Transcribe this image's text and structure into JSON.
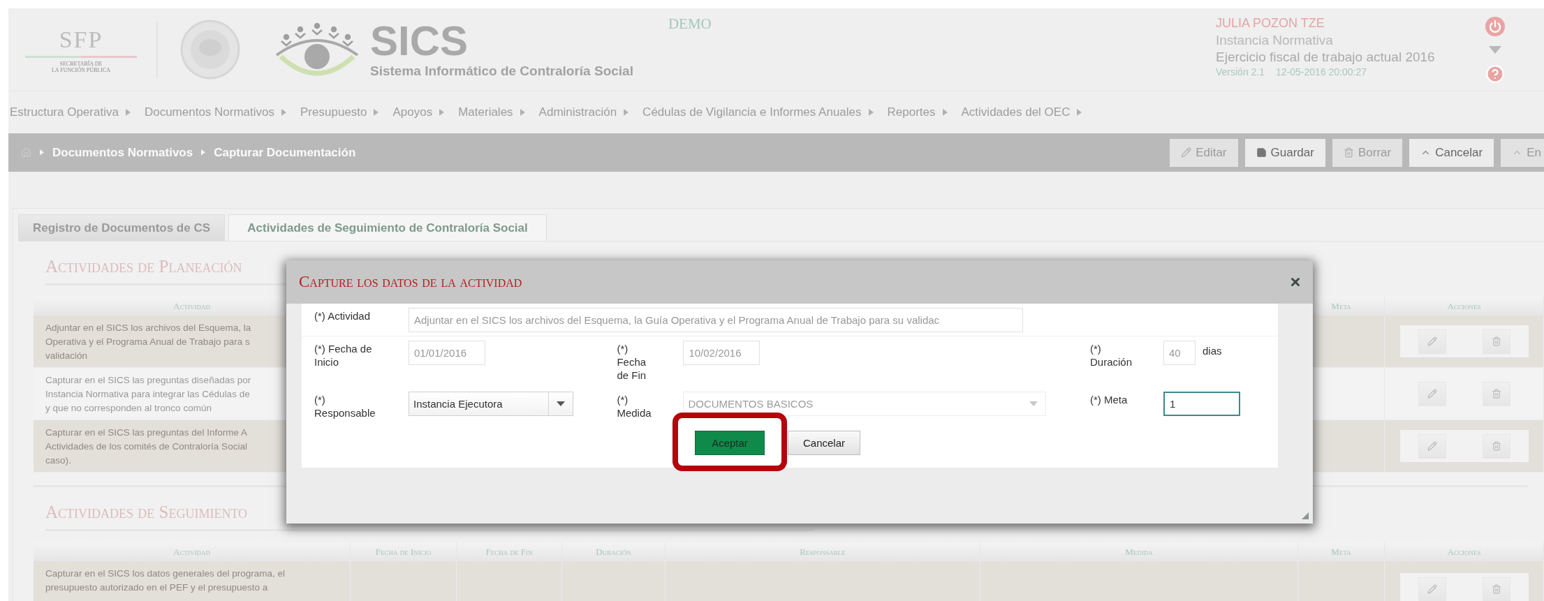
{
  "header": {
    "sfp_logo": {
      "title": "SFP",
      "lines": [
        "SECRETARÍA DE",
        "LA FUNCIÓN PÚBLICA"
      ]
    },
    "app": {
      "name": "SICS",
      "subtitle": "Sistema Informático de Contraloría Social"
    },
    "environment": "DEMO",
    "user": {
      "name": "JULIA POZON TZE",
      "role": "Instancia Normativa",
      "fiscal_year": "Ejercicio fiscal de trabajo actual  2016",
      "version": "Versión 2.1",
      "timestamp": "12-05-2016 20:00:27"
    }
  },
  "menu": [
    "Estructura Operativa",
    "Documentos Normativos",
    "Presupuesto",
    "Apoyos",
    "Materiales",
    "Administración",
    "Cédulas de Vigilancia e Informes Anuales",
    "Reportes",
    "Actividades del OEC"
  ],
  "breadcrumb": [
    "Documentos Normativos",
    "Capturar Documentación"
  ],
  "toolbar": [
    {
      "label": "Editar",
      "disabled": true
    },
    {
      "label": "Guardar",
      "disabled": false
    },
    {
      "label": "Borrar",
      "disabled": true
    },
    {
      "label": "Cancelar",
      "disabled": false
    },
    {
      "label": "En",
      "disabled": true
    }
  ],
  "tabs": [
    {
      "label": "Registro de Documentos de CS",
      "selected": false
    },
    {
      "label": "Actividades de Seguimiento de Contraloría Social",
      "selected": true
    }
  ],
  "sections": [
    {
      "title": "Actividades de Planeación",
      "columns": [
        {
          "label": "Actividad",
          "kind": "activity"
        },
        {
          "label": "Meta",
          "kind": "plain"
        },
        {
          "label": "Acciones",
          "kind": "actions"
        }
      ],
      "rows": [
        {
          "lines": [
            "Adjuntar en el SICS los archivos del Esquema, la",
            "Operativa y el Programa Anual de Trabajo para s",
            "validación"
          ],
          "shaded": true
        },
        {
          "lines": [
            "Capturar en el SICS las preguntas diseñadas por",
            "Instancia Normativa para integrar las Cédulas de",
            "y que no corresponden al tronco común"
          ],
          "shaded": false
        },
        {
          "lines": [
            "Capturar en el SICS las preguntas del Informe A",
            "Actividades de los comités de Contraloría Social",
            "caso)."
          ],
          "shaded": true
        }
      ]
    },
    {
      "title": "Actividades de Seguimiento",
      "columns": [
        {
          "label": "Actividad",
          "kind": "activity"
        },
        {
          "label": "Fecha de Inicio",
          "kind": "plain"
        },
        {
          "label": "Fecha de Fin",
          "kind": "plain"
        },
        {
          "label": "Duración",
          "kind": "plain"
        },
        {
          "label": "Responsable",
          "kind": "plain"
        },
        {
          "label": "Medida",
          "kind": "plain"
        },
        {
          "label": "Meta",
          "kind": "plain"
        },
        {
          "label": "Acciones",
          "kind": "actions"
        }
      ],
      "rows": [
        {
          "lines": [
            "Capturar en el SICS los datos generales del programa, el",
            "presupuesto autorizado en el PEF y el presupuesto a"
          ],
          "shaded": true
        }
      ]
    }
  ],
  "dialog": {
    "title": "Capture los datos de la actividad",
    "rows": [
      [
        {
          "label_lines": [
            "(*) Actividad"
          ],
          "kind": "text",
          "value": "Adjuntar en el SICS los archivos del Esquema, la Guía Operativa y el Programa Anual de Trabajo para su validac",
          "disabled": true,
          "focused": false
        }
      ],
      [
        {
          "label_lines": [
            "(*) Fecha de",
            "Inicio"
          ],
          "kind": "text",
          "value": "01/01/2016",
          "disabled": true,
          "focused": false
        },
        {
          "label_lines": [
            "(*)",
            "Fecha",
            "de Fin"
          ],
          "kind": "text",
          "value": "10/02/2016",
          "disabled": true,
          "focused": false
        },
        {
          "label_lines": [
            "(*)",
            "Duración"
          ],
          "kind": "text",
          "value": "40",
          "disabled": true,
          "focused": false,
          "suffix": "dias"
        }
      ],
      [
        {
          "label_lines": [
            "(*)",
            "Responsable"
          ],
          "kind": "select",
          "value": "Instancia Ejecutora",
          "disabled": false,
          "focused": false
        },
        {
          "label_lines": [
            "(*)",
            "Medida"
          ],
          "kind": "select",
          "value": "DOCUMENTOS BASICOS",
          "disabled": true,
          "focused": false
        },
        {
          "label_lines": [
            "(*) Meta"
          ],
          "kind": "text",
          "value": "1",
          "disabled": false,
          "focused": true
        }
      ]
    ],
    "buttons": [
      {
        "label": "Aceptar",
        "kind": "primary",
        "highlighted": true
      },
      {
        "label": "Cancelar",
        "kind": "secondary",
        "highlighted": false
      }
    ]
  }
}
